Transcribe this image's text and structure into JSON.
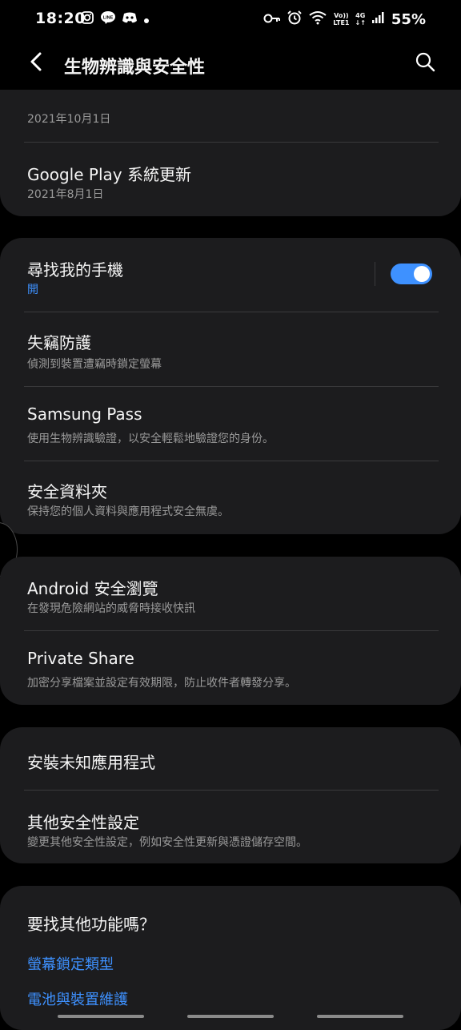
{
  "status_bar": {
    "time": "18:20",
    "battery": "55%",
    "volte_top": "Vo))",
    "volte_bottom": "LTE1",
    "network_top": "4G",
    "network_bottom": "↓↑",
    "icons": [
      "instagram-icon",
      "line-icon",
      "discord-icon",
      "dot-icon",
      "key-icon",
      "alarm-icon",
      "wifi-icon",
      "signal-icon"
    ]
  },
  "header": {
    "title": "生物辨識與安全性",
    "back_icon": "back-arrow-icon",
    "search_icon": "search-icon"
  },
  "updates_card": {
    "partial_row": {
      "subtitle": "2021年10月1日"
    },
    "google_play_update": {
      "title": "Google Play 系統更新",
      "subtitle": "2021年8月1日"
    }
  },
  "security_card": {
    "find_my_phone": {
      "title": "尋找我的手機",
      "status": "開",
      "toggle_on": true
    },
    "theft_protection": {
      "title": "失竊防護",
      "subtitle": "偵測到裝置遭竊時鎖定螢幕"
    },
    "samsung_pass": {
      "title": "Samsung Pass",
      "subtitle": "使用生物辨識驗證，以安全輕鬆地驗證您的身份。"
    },
    "secure_folder": {
      "title": "安全資料夾",
      "subtitle": "保持您的個人資料與應用程式安全無虞。"
    }
  },
  "browsing_card": {
    "safe_browsing": {
      "title": "Android 安全瀏覽",
      "subtitle": "在發現危險網站的威脅時接收快訊"
    },
    "private_share": {
      "title": "Private Share",
      "subtitle": "加密分享檔案並設定有效期限，防止收件者轉發分享。"
    }
  },
  "other_card": {
    "install_unknown": {
      "title": "安裝未知應用程式"
    },
    "other_settings": {
      "title": "其他安全性設定",
      "subtitle": "變更其他安全性設定，例如安全性更新與憑證儲存空間。"
    }
  },
  "suggestions_card": {
    "heading": "要找其他功能嗎？",
    "links": [
      "螢幕鎖定類型",
      "電池與裝置維護"
    ]
  },
  "colors": {
    "accent": "#3e91ff",
    "card_bg": "#1c1c1e",
    "background": "#000000"
  }
}
